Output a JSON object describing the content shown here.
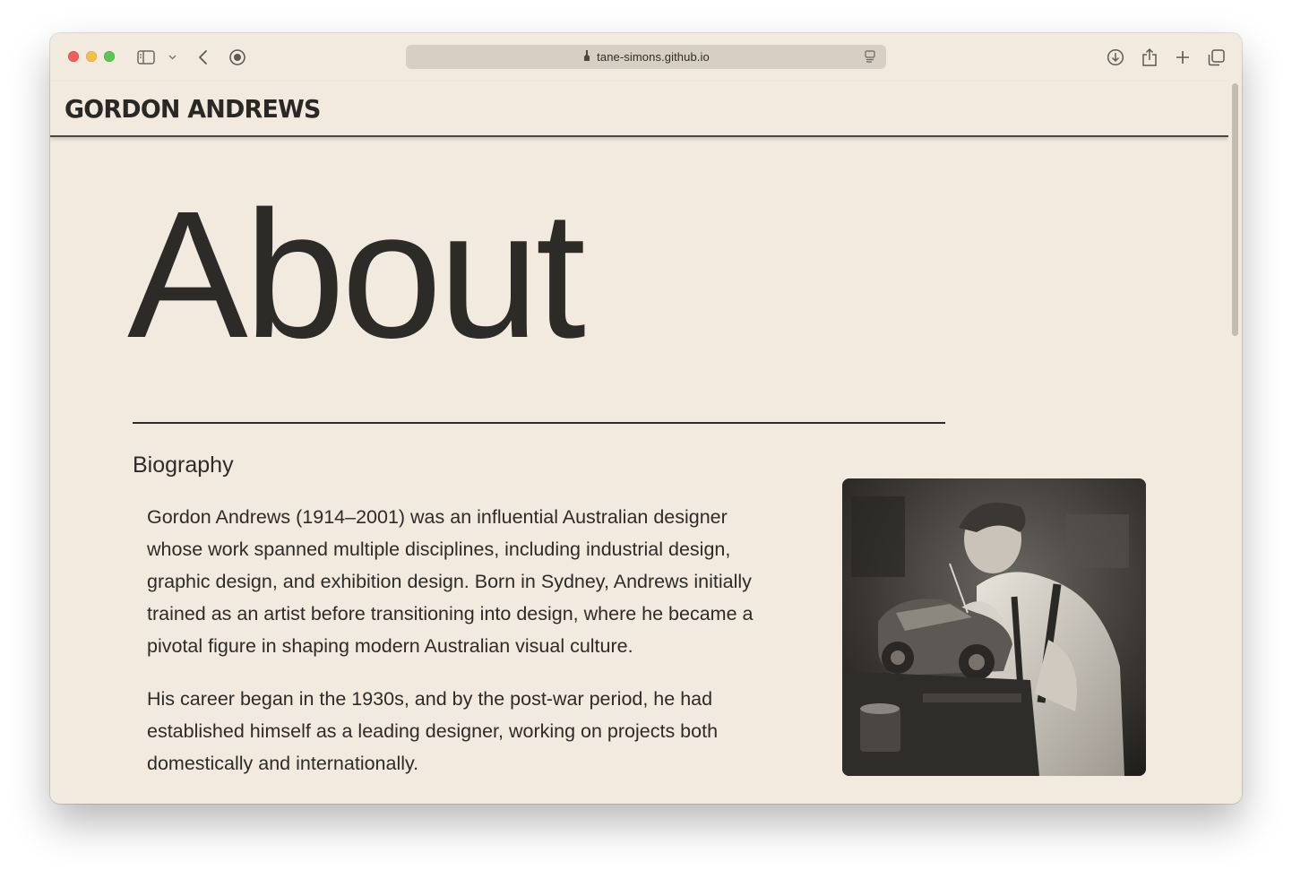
{
  "browser": {
    "url": "tane-simons.github.io",
    "icons": {
      "sidebar": "sidebar-icon",
      "sidebar_menu": "chevron-down-icon",
      "back": "back-icon",
      "privacy": "privacy-report-icon",
      "site": "site-favicon-icon",
      "reader": "reader-mode-icon",
      "downloads": "download-icon",
      "share": "share-icon",
      "new_tab": "plus-icon",
      "tabs": "tab-overview-icon"
    }
  },
  "site": {
    "brand": "GORDON ANDREWS"
  },
  "page": {
    "title": "About",
    "section_title": "Biography",
    "paragraphs": [
      "Gordon Andrews (1914–2001) was an influential Australian designer whose work spanned multiple disciplines, including industrial design, graphic design, and exhibition design. Born in Sydney, Andrews initially trained as an artist before transitioning into design, where he became a pivotal figure in shaping modern Australian visual culture.",
      "His career began in the 1930s, and by the post-war period, he had established himself as a leading designer, working on projects both domestically and internationally."
    ]
  },
  "theme": {
    "background": "#f2eadf",
    "text": "#2d2b28",
    "address_bar": "#d8cfc3"
  }
}
